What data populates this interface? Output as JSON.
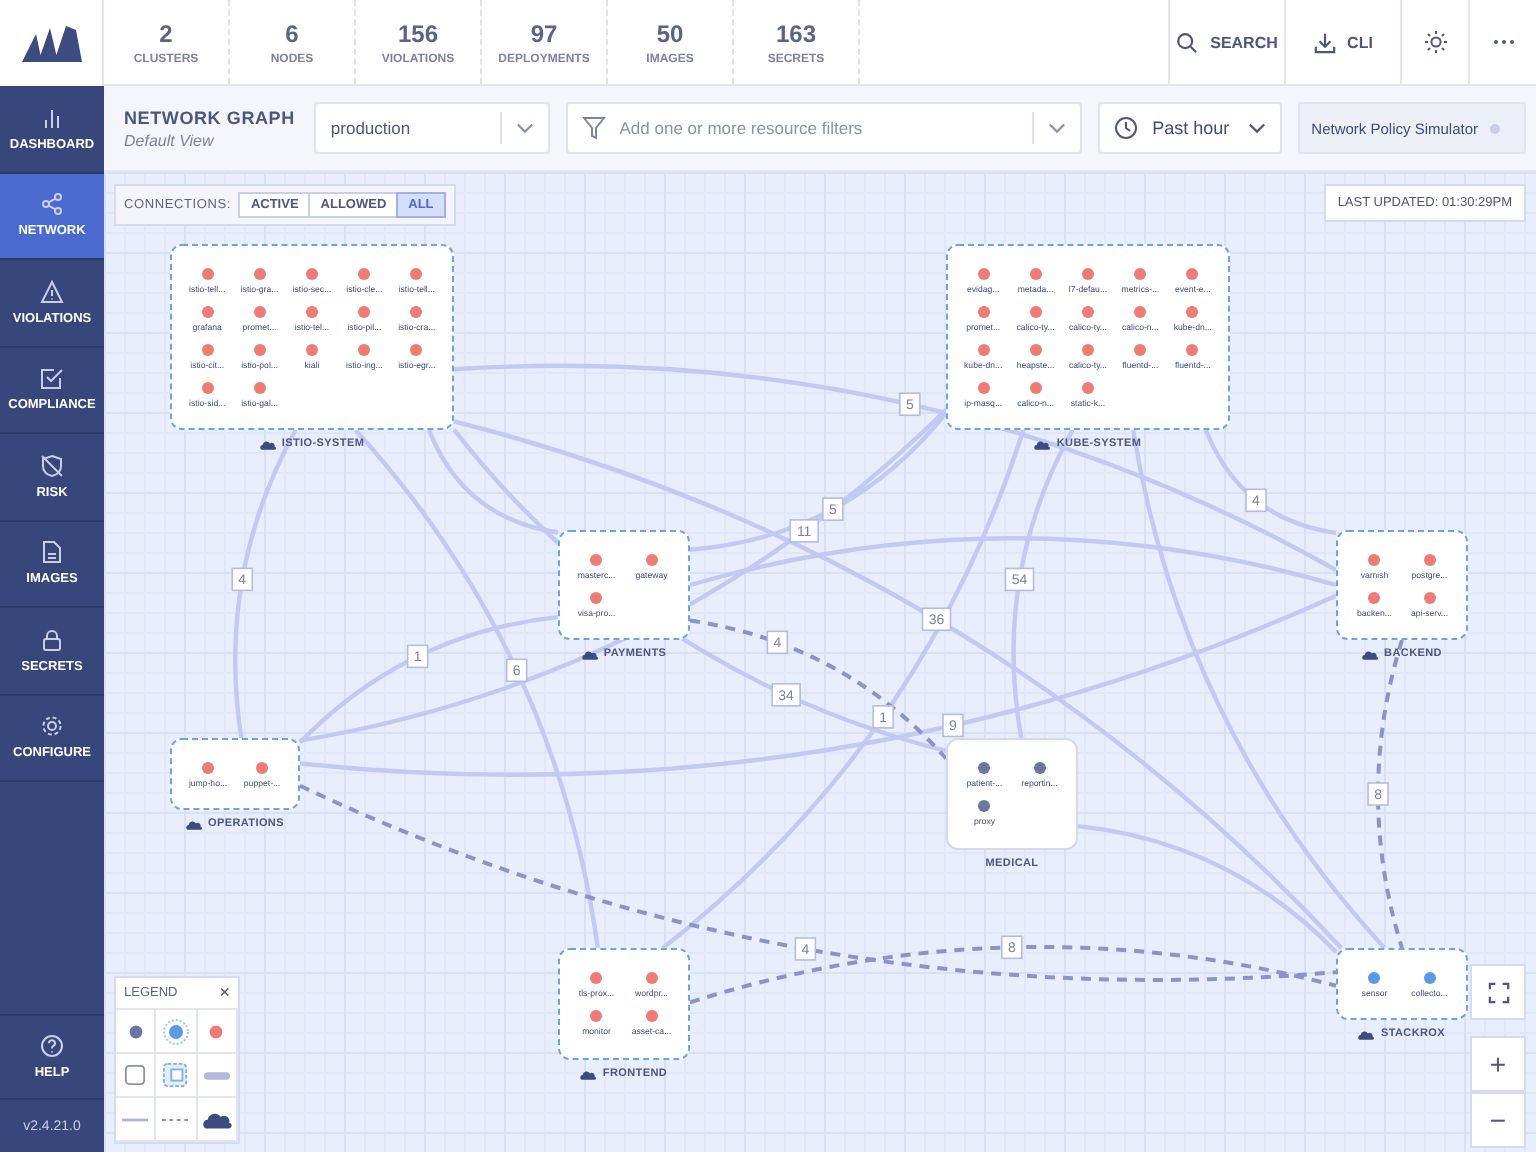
{
  "topbar": {
    "stats": [
      {
        "value": "2",
        "label": "CLUSTERS"
      },
      {
        "value": "6",
        "label": "NODES"
      },
      {
        "value": "156",
        "label": "VIOLATIONS"
      },
      {
        "value": "97",
        "label": "DEPLOYMENTS"
      },
      {
        "value": "50",
        "label": "IMAGES"
      },
      {
        "value": "163",
        "label": "SECRETS"
      }
    ],
    "actions": [
      {
        "kind": "search",
        "label": "SEARCH"
      },
      {
        "kind": "cli",
        "label": "CLI"
      },
      {
        "kind": "theme"
      },
      {
        "kind": "more"
      }
    ]
  },
  "sidebar": {
    "items": [
      {
        "kind": "dashboard",
        "label": "DASHBOARD",
        "selected": false
      },
      {
        "kind": "network",
        "label": "NETWORK",
        "selected": true
      },
      {
        "kind": "violations",
        "label": "VIOLATIONS",
        "selected": false
      },
      {
        "kind": "compliance",
        "label": "COMPLIANCE",
        "selected": false
      },
      {
        "kind": "risk",
        "label": "RISK",
        "selected": false
      },
      {
        "kind": "images",
        "label": "IMAGES",
        "selected": false
      },
      {
        "kind": "secrets",
        "label": "SECRETS",
        "selected": false
      },
      {
        "kind": "configure",
        "label": "CONFIGURE",
        "selected": false
      }
    ],
    "help": "HELP",
    "version": "v2.4.21.0"
  },
  "header": {
    "title": "NETWORK GRAPH",
    "subtitle": "Default View",
    "cluster_select": {
      "value": "production"
    },
    "filter": {
      "placeholder": "Add one or more resource filters"
    },
    "time_select": {
      "value": "Past hour"
    },
    "simulator_button": "Network Policy Simulator"
  },
  "graph": {
    "connections": {
      "label": "CONNECTIONS:",
      "options": [
        {
          "label": "ACTIVE",
          "selected": false
        },
        {
          "label": "ALLOWED",
          "selected": false
        },
        {
          "label": "ALL",
          "selected": true
        }
      ]
    },
    "last_updated": "LAST UPDATED: 01:30:29PM",
    "namespaces": [
      {
        "name": "ISTIO-SYSTEM",
        "external_egress": true,
        "deployments": [
          {
            "name": "istio-tell...",
            "color": "#ef7b76"
          },
          {
            "name": "istio-gra...",
            "color": "#ef7b76"
          },
          {
            "name": "istio-sec...",
            "color": "#ef7b76"
          },
          {
            "name": "istio-cle...",
            "color": "#ef7b76"
          },
          {
            "name": "istio-tell...",
            "color": "#ef7b76"
          },
          {
            "name": "grafana",
            "color": "#ef7b76"
          },
          {
            "name": "promet...",
            "color": "#ef7b76"
          },
          {
            "name": "istio-tel...",
            "color": "#ef7b76"
          },
          {
            "name": "istio-pil...",
            "color": "#ef7b76"
          },
          {
            "name": "istio-cra...",
            "color": "#ef7b76"
          },
          {
            "name": "istio-cit...",
            "color": "#ef7b76"
          },
          {
            "name": "istio-pol...",
            "color": "#ef7b76"
          },
          {
            "name": "kiali",
            "color": "#ef7b76"
          },
          {
            "name": "istio-ing...",
            "color": "#ef7b76"
          },
          {
            "name": "istio-egr...",
            "color": "#ef7b76"
          },
          {
            "name": "istio-sid...",
            "color": "#ef7b76"
          },
          {
            "name": "istio-gal...",
            "color": "#ef7b76"
          }
        ]
      },
      {
        "name": "KUBE-SYSTEM",
        "external_egress": true,
        "deployments": [
          {
            "name": "evidag...",
            "color": "#ef7b76"
          },
          {
            "name": "metada...",
            "color": "#ef7b76"
          },
          {
            "name": "l7-defau...",
            "color": "#ef7b76"
          },
          {
            "name": "metrics-...",
            "color": "#ef7b76"
          },
          {
            "name": "event-e...",
            "color": "#ef7b76"
          },
          {
            "name": "promet...",
            "color": "#ef7b76"
          },
          {
            "name": "calico-ty...",
            "color": "#ef7b76"
          },
          {
            "name": "calico-ty...",
            "color": "#ef7b76"
          },
          {
            "name": "calico-n...",
            "color": "#ef7b76"
          },
          {
            "name": "kube-dn...",
            "color": "#ef7b76"
          },
          {
            "name": "kube-dn...",
            "color": "#ef7b76"
          },
          {
            "name": "heapste...",
            "color": "#ef7b76"
          },
          {
            "name": "calico-ty...",
            "color": "#ef7b76"
          },
          {
            "name": "fluentd-...",
            "color": "#ef7b76"
          },
          {
            "name": "fluentd-...",
            "color": "#ef7b76"
          },
          {
            "name": "ip-masq...",
            "color": "#ef7b76"
          },
          {
            "name": "calico-n...",
            "color": "#ef7b76"
          },
          {
            "name": "static-k...",
            "color": "#ef7b76"
          }
        ]
      },
      {
        "name": "PAYMENTS",
        "external_egress": true,
        "deployments": [
          {
            "name": "masterc...",
            "color": "#ef7b76"
          },
          {
            "name": "gateway",
            "color": "#ef7b76"
          },
          {
            "name": "visa-pro...",
            "color": "#ef7b76"
          }
        ]
      },
      {
        "name": "BACKEND",
        "external_egress": true,
        "deployments": [
          {
            "name": "varnish",
            "color": "#ef7b76"
          },
          {
            "name": "postgre...",
            "color": "#ef7b76"
          },
          {
            "name": "backen...",
            "color": "#ef7b76"
          },
          {
            "name": "api-serv...",
            "color": "#ef7b76"
          }
        ]
      },
      {
        "name": "OPERATIONS",
        "external_egress": true,
        "deployments": [
          {
            "name": "jump-ho...",
            "color": "#ef7b76"
          },
          {
            "name": "puppet-...",
            "color": "#ef7b76"
          }
        ]
      },
      {
        "name": "MEDICAL",
        "external_egress": false,
        "deployments": [
          {
            "name": "patient-...",
            "color": "#6c74a0"
          },
          {
            "name": "reportin...",
            "color": "#6c74a0"
          },
          {
            "name": "proxy",
            "color": "#6c74a0"
          }
        ]
      },
      {
        "name": "FRONTEND",
        "external_egress": true,
        "deployments": [
          {
            "name": "tls-prox...",
            "color": "#ef7b76"
          },
          {
            "name": "wordpr...",
            "color": "#ef7b76"
          },
          {
            "name": "monitor",
            "color": "#ef7b76"
          },
          {
            "name": "asset-ca...",
            "color": "#ef7b76"
          }
        ]
      },
      {
        "name": "STACKROX",
        "external_egress": true,
        "deployments": [
          {
            "name": "sensor",
            "color": "#5a9be6"
          },
          {
            "name": "collecto...",
            "color": "#5a9be6"
          }
        ]
      }
    ],
    "edges": [
      {
        "label": "5",
        "dashed": false
      },
      {
        "label": "34",
        "dashed": false
      },
      {
        "label": "6",
        "dashed": false
      },
      {
        "label": "4",
        "dashed": false
      },
      {
        "label": "36",
        "dashed": false
      },
      {
        "dashed": false
      },
      {
        "label": "5",
        "dashed": false
      },
      {
        "label": "4",
        "dashed": false
      },
      {
        "label": "1",
        "dashed": false
      },
      {
        "label": "54",
        "dashed": false
      },
      {
        "label": "11",
        "dashed": false
      },
      {
        "label": "1",
        "dashed": false
      },
      {
        "dashed": false
      },
      {
        "label": "9",
        "dashed": false
      },
      {
        "label": "4",
        "dashed": true
      },
      {
        "label": "4",
        "dashed": true
      },
      {
        "label": "8",
        "dashed": true
      },
      {
        "label": "8",
        "dashed": true
      },
      {
        "dashed": false
      },
      {
        "dashed": false
      }
    ],
    "legend": {
      "title": "LEGEND",
      "close": "×"
    },
    "zoom": {
      "in": "+",
      "out": "−"
    }
  }
}
